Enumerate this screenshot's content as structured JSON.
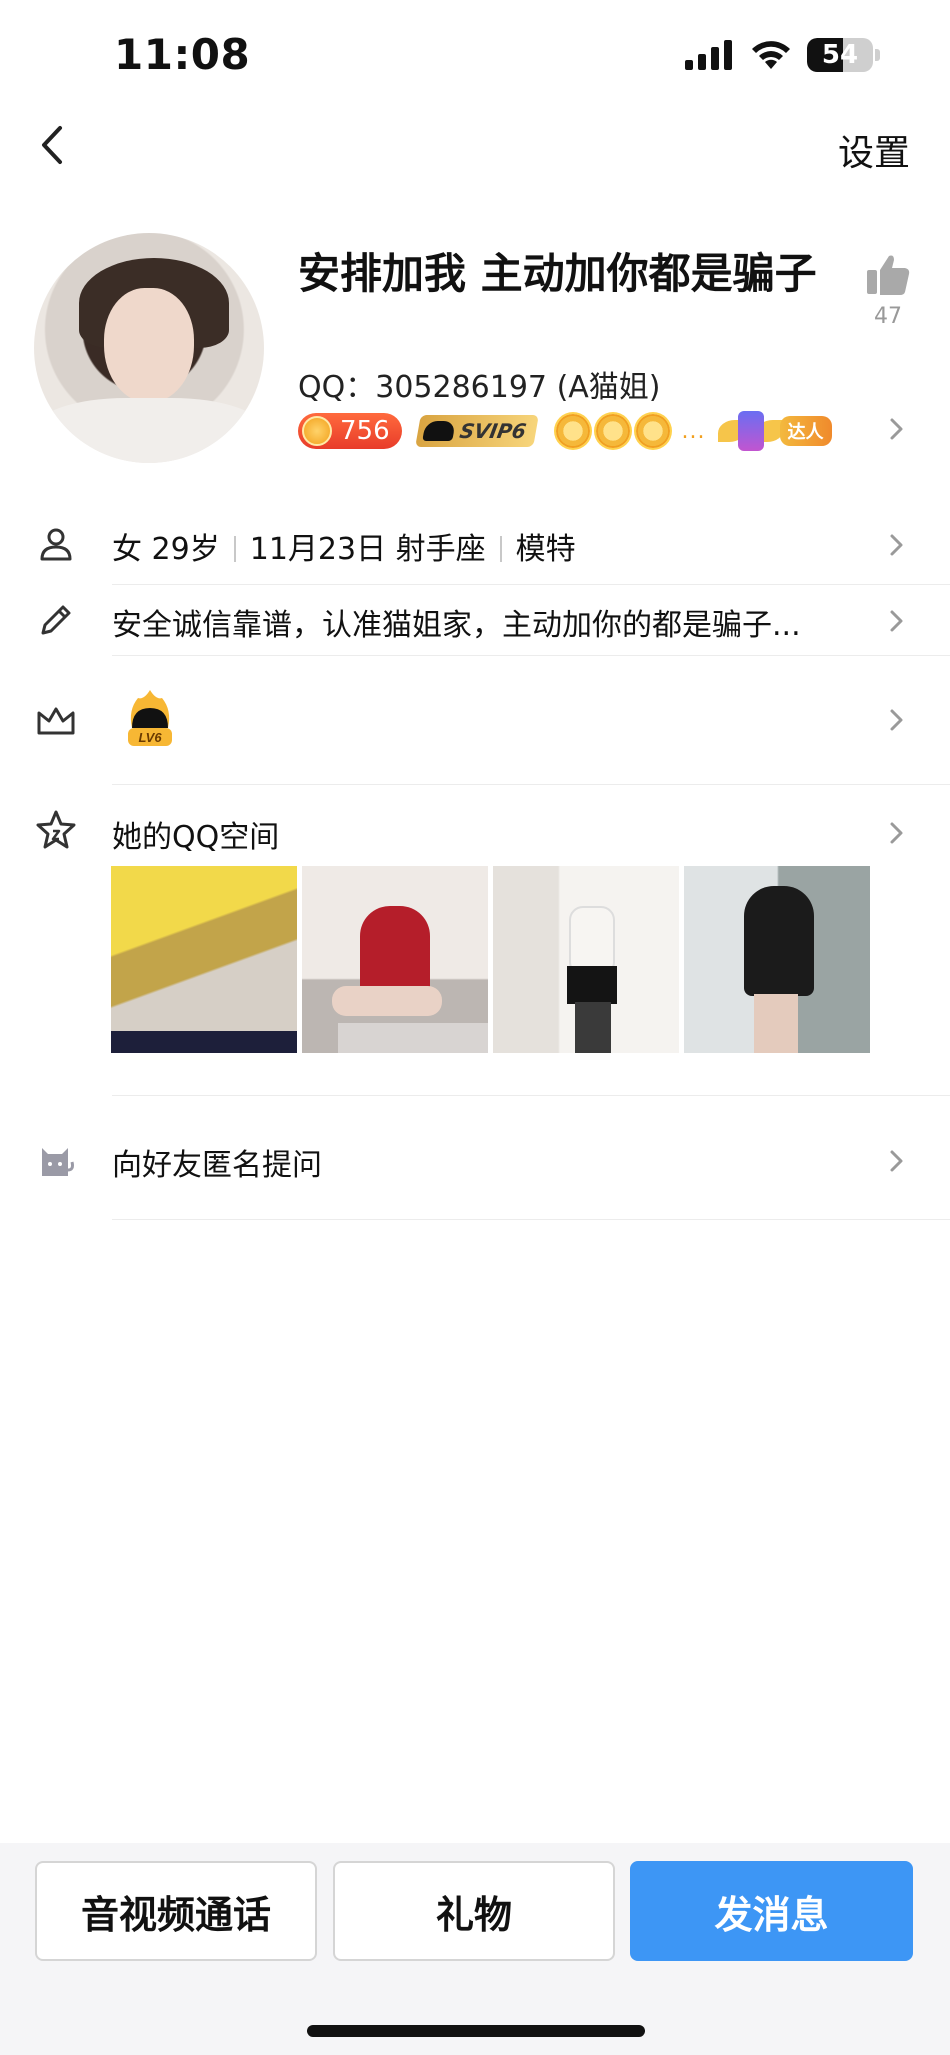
{
  "status_bar": {
    "time": "11:08",
    "battery": "54",
    "battery_level": 0.54
  },
  "nav": {
    "settings_label": "设置"
  },
  "profile": {
    "name": "安排加我 主动加你都是骗子",
    "qq_label": "QQ：",
    "qq_number": "305286197",
    "remark": "(A猫姐)",
    "likes": "47"
  },
  "badges": {
    "coin_value": "756",
    "svip_label": "SVIP6",
    "more": "...",
    "daren_label": "达人"
  },
  "info": {
    "gender": "女",
    "age": "29岁",
    "birthday": "11月23日",
    "zodiac": "射手座",
    "job": "模特"
  },
  "signature": "安全诚信靠谱，认准猫姐家，主动加你的都是骗子...",
  "level_badge_label": "LV6",
  "qzone": {
    "title": "她的QQ空间"
  },
  "anonymous_question": "向好友匿名提问",
  "actions": {
    "call": "音视频通话",
    "gift": "礼物",
    "message": "发消息"
  },
  "colors": {
    "primary": "#3d96f5",
    "background": "#ffffff",
    "bottom_bar": "#f5f5f7"
  }
}
